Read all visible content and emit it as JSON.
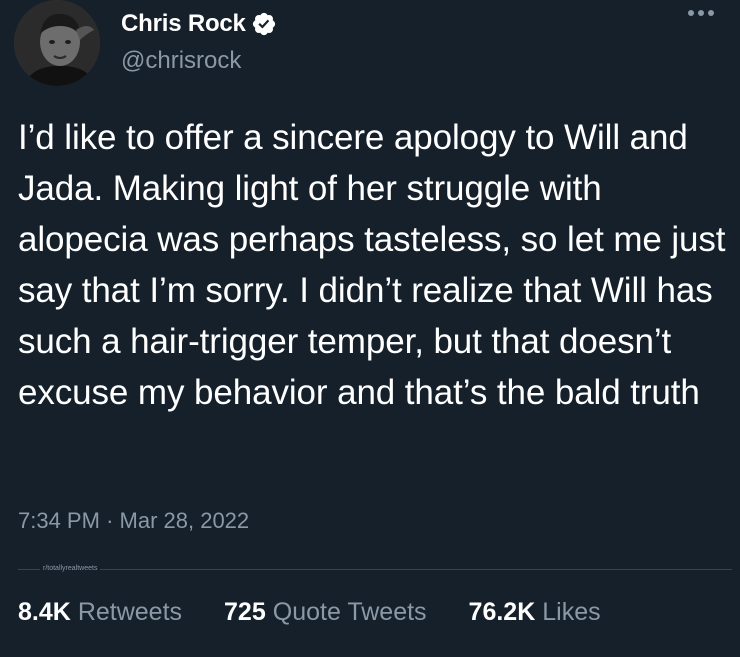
{
  "author": {
    "display_name": "Chris Rock",
    "handle": "@chrisrock",
    "verified": true,
    "avatar_icon": "profile-photo-icon"
  },
  "tweet": {
    "text": "I’d like to offer a sincere apology to Will and Jada. Making light of her struggle with alopecia was perhaps tasteless, so let me just say that I’m sorry. I didn’t realize that Will has such a hair-trigger temper, but that doesn’t excuse my behavior and that’s the bald truth",
    "time": "7:34 PM",
    "separator": "·",
    "date": "Mar 28, 2022"
  },
  "watermark": "r/totallyrealtweets",
  "stats": {
    "retweets": {
      "count": "8.4K",
      "label": "Retweets"
    },
    "quote_tweets": {
      "count": "725",
      "label": "Quote Tweets"
    },
    "likes": {
      "count": "76.2K",
      "label": "Likes"
    }
  },
  "colors": {
    "background": "#15202b",
    "text": "#ffffff",
    "secondary_text": "#8b98a5",
    "verified_badge": "#ffffff",
    "divider": "#38444d"
  }
}
